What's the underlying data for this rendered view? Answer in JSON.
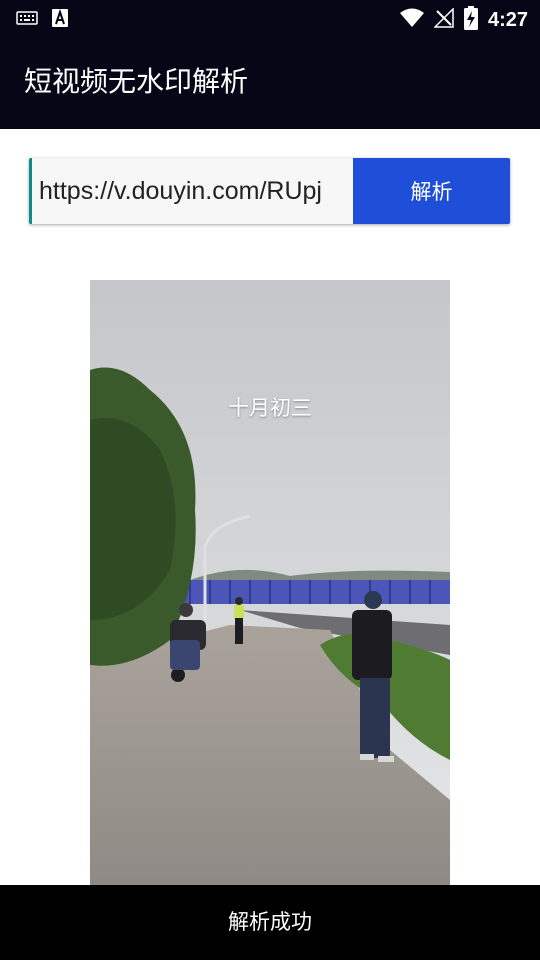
{
  "status_bar": {
    "time": "4:27",
    "icons": [
      "keyboard-icon",
      "font-a-icon",
      "wifi-icon",
      "no-signal-icon",
      "battery-charging-icon"
    ]
  },
  "app_bar": {
    "title": "短视频无水印解析"
  },
  "url_input": {
    "value": "https://v.douyin.com/RUpj"
  },
  "parse_button": {
    "label": "解析"
  },
  "video": {
    "caption": "十月初三"
  },
  "toast": {
    "message": "解析成功"
  },
  "colors": {
    "app_bar": "#060616",
    "button": "#1f4fd8",
    "toast": "#000000"
  }
}
